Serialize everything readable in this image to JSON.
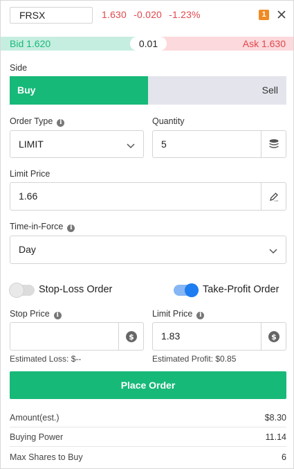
{
  "header": {
    "symbol": "FRSX",
    "last_price": "1.630",
    "change": "-0.020",
    "change_pct": "-1.23%",
    "badge": "1",
    "close_icon": "close-icon"
  },
  "quote_bar": {
    "bid": "Bid 1.620",
    "spread": "0.01",
    "ask": "Ask 1.630",
    "bid_color": "#17b978",
    "ask_color": "#e0474c"
  },
  "side": {
    "label": "Side",
    "buy_label": "Buy",
    "sell_label": "Sell",
    "selected": "Buy"
  },
  "order_type": {
    "label": "Order Type",
    "value": "LIMIT",
    "icon": "chevron-down-icon"
  },
  "quantity": {
    "label": "Quantity",
    "value": "5",
    "icon": "coin-stack-icon"
  },
  "limit_price": {
    "label": "Limit Price",
    "value": "1.66",
    "icon": "pencil-icon"
  },
  "time_in_force": {
    "label": "Time-in-Force",
    "value": "Day",
    "icon": "chevron-down-icon"
  },
  "stop_loss": {
    "label": "Stop-Loss Order",
    "enabled": false,
    "price_label": "Stop Price",
    "price_value": "",
    "estimate": "Estimated Loss: $--"
  },
  "take_profit": {
    "label": "Take-Profit Order",
    "enabled": true,
    "price_label": "Limit Price",
    "price_value": "1.83",
    "estimate": "Estimated Profit: $0.85"
  },
  "actions": {
    "place_order": "Place Order"
  },
  "summary": [
    {
      "label": "Amount(est.)",
      "value": "$8.30"
    },
    {
      "label": "Buying Power",
      "value": "11.14"
    },
    {
      "label": "Max Shares to Buy",
      "value": "6"
    }
  ],
  "colors": {
    "accent_green": "#17b978",
    "accent_red": "#e0474c",
    "toggle_blue": "#1e7df0",
    "badge_orange": "#f08a24"
  }
}
